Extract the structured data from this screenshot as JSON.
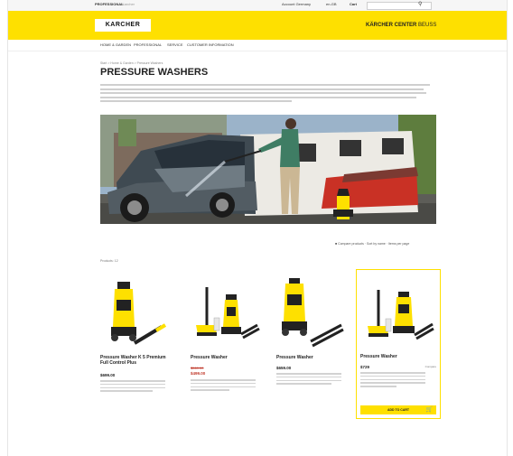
{
  "topbar": {
    "left_link": "PROFESSIONAL",
    "left_sub": "Karcher",
    "account": "Account Germany",
    "country": "en-GB",
    "cart": "Cart",
    "search_placeholder": "Search"
  },
  "brand": {
    "logo": "KARCHER",
    "center_name": "KÄRCHER CENTER",
    "center_location": "BEUSS"
  },
  "nav": [
    "HOME & GARDEN",
    "PROFESSIONAL",
    "SERVICE",
    "CUSTOMER INFORMATION"
  ],
  "breadcrumb": "Start > Home & Garden > Pressure Washers",
  "page_title": "PRESSURE WASHERS",
  "filter_row": "■ Compare products  ·  Sort by name  ·  Items per page",
  "results_label": "Products: 12",
  "products": [
    {
      "name": "Pressure Washer K 5 Premium Full Control Plus",
      "price": "$699.00",
      "old_price": "",
      "sale_price": "",
      "right_note": ""
    },
    {
      "name": "Pressure Washer",
      "price": "",
      "old_price": "$569.00",
      "sale_price": "$499.00",
      "right_note": ""
    },
    {
      "name": "Pressure Washer",
      "price": "$659.00",
      "old_price": "",
      "sale_price": "",
      "right_note": ""
    },
    {
      "name": "Pressure Washer",
      "price": "$729",
      "old_price": "",
      "sale_price": "",
      "right_note": "Compare",
      "button": "ADD TO CART"
    }
  ],
  "colors": {
    "brand_yellow": "#fee000",
    "sale_red": "#c0392b"
  }
}
